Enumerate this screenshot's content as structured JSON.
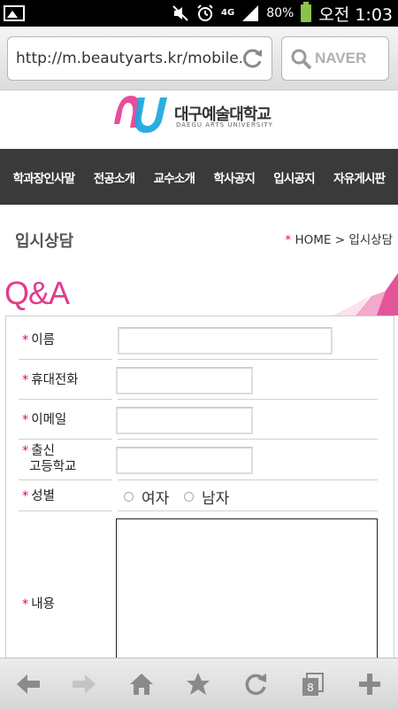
{
  "status_bar": {
    "network": "4G",
    "battery": "80%",
    "clock": "오전 1:03"
  },
  "browser": {
    "url": "http://m.beautyarts.kr/mobile...",
    "search_engine": "NAVER"
  },
  "logo": {
    "korean": "대구예술대학교",
    "english": "DAEGU ARTS UNIVERSITY",
    "colors": {
      "pink": "#e94c9b",
      "blue": "#1aa6e0"
    }
  },
  "nav": {
    "items": [
      {
        "label": "학과장인사말"
      },
      {
        "label": "전공소개"
      },
      {
        "label": "교수소개"
      },
      {
        "label": "학사공지"
      },
      {
        "label": "입시공지"
      },
      {
        "label": "자유게시판"
      }
    ]
  },
  "page": {
    "title": "입시상담",
    "breadcrumb_star": "*",
    "breadcrumb": "HOME > 입시상담",
    "qa_title": "Q&A"
  },
  "form": {
    "required_mark": "*",
    "name_label": "이름",
    "phone_label": "휴대전화",
    "email_label": "이메일",
    "school_label_line1": "출신",
    "school_label_line2": "고등학교",
    "gender_label": "성별",
    "gender_options": [
      "여자",
      "남자"
    ],
    "content_label": "내용",
    "name_value": "",
    "phone_value": "",
    "email_value": "",
    "school_value": ""
  },
  "toolbar": {
    "tabs_count": "8"
  }
}
